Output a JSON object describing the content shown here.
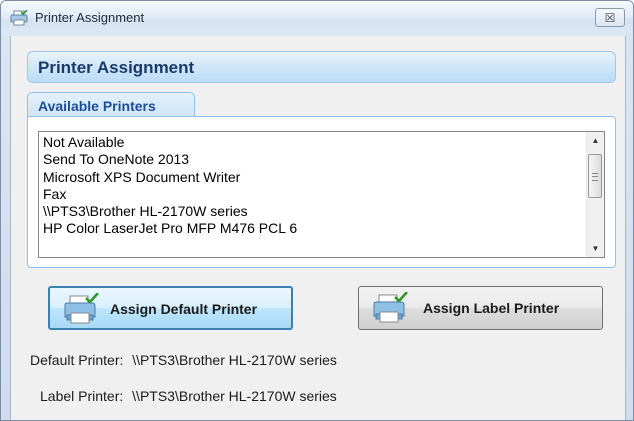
{
  "window": {
    "title": "Printer Assignment",
    "close_glyph": "☒"
  },
  "header": {
    "title": "Printer Assignment"
  },
  "available_printers": {
    "group_label": "Available Printers",
    "items": [
      "Not Available",
      "Send To OneNote 2013",
      "Microsoft XPS Document Writer",
      "Fax",
      "\\\\PTS3\\Brother HL-2170W series",
      "HP Color LaserJet Pro MFP M476 PCL 6"
    ]
  },
  "buttons": {
    "assign_default": "Assign Default Printer",
    "assign_label": "Assign Label Printer"
  },
  "status": {
    "default_label": "Default Printer:",
    "default_value": "\\\\PTS3\\Brother HL-2170W series",
    "label_label": "Label Printer:",
    "label_value": "\\\\PTS3\\Brother HL-2170W series"
  },
  "icons": {
    "title": "printer-icon",
    "button": "printer-check-icon"
  },
  "colors": {
    "header_text": "#1a3a6a",
    "group_text": "#1e4e96",
    "accent_border": "#3c7fb1"
  }
}
